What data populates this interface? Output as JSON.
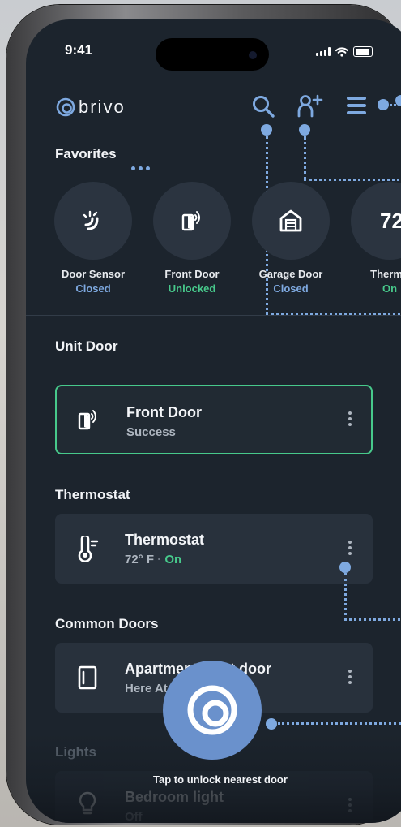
{
  "status_bar": {
    "time": "9:41"
  },
  "header": {
    "brand": "brivo"
  },
  "favorites": {
    "title": "Favorites",
    "items": [
      {
        "name": "Door Sensor",
        "status": "Closed",
        "status_color": "#7ea9e0",
        "icon": "door-sensor-icon"
      },
      {
        "name": "Front Door",
        "status": "Unlocked",
        "status_color": "#47c98b",
        "icon": "wireless-door-icon"
      },
      {
        "name": "Garage Door",
        "status": "Closed",
        "status_color": "#7ea9e0",
        "icon": "garage-icon"
      },
      {
        "name": "Thermo",
        "status": "On",
        "status_color": "#47c98b",
        "value": "72"
      }
    ]
  },
  "unit_door": {
    "title": "Unit Door",
    "card": {
      "name": "Front Door",
      "status": "Success"
    }
  },
  "thermostat": {
    "title": "Thermostat",
    "card": {
      "name": "Thermostat",
      "temp": "72° F",
      "separator": "·",
      "state": "On"
    }
  },
  "common_doors": {
    "title": "Common Doors",
    "card": {
      "name": "Apartment front door",
      "location": "Here At"
    }
  },
  "lights": {
    "title": "Lights",
    "card": {
      "name": "Bedroom light",
      "status": "Off"
    }
  },
  "unlock": {
    "label": "Tap to unlock nearest door"
  },
  "colors": {
    "accent": "#7ea9e0",
    "success": "#47c98b",
    "background": "#1c242d",
    "card": "#28313c",
    "unlock_button": "#6a91cc"
  }
}
